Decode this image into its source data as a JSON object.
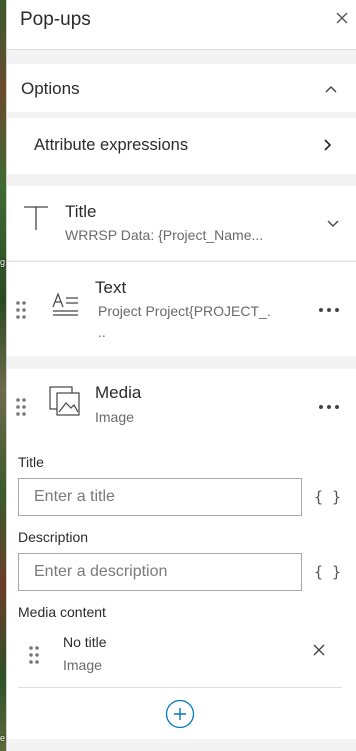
{
  "map": {
    "edge_label_1": "g",
    "edge_label_2": "e"
  },
  "header": {
    "title": "Pop-ups"
  },
  "options": {
    "label": "Options",
    "attribute_expressions": "Attribute expressions"
  },
  "title_element": {
    "label": "Title",
    "value": "WRRSP Data: {Project_Name..."
  },
  "text_element": {
    "label": "Text",
    "line1": "Project Project{PROJECT_.",
    "line2": ".."
  },
  "media_element": {
    "label": "Media",
    "sub": "Image",
    "title_label": "Title",
    "title_placeholder": "Enter a title",
    "description_label": "Description",
    "description_placeholder": "Enter a description",
    "expression_glyph": "{ }",
    "media_content_label": "Media content",
    "item_title": "No title",
    "item_type": "Image"
  },
  "colors": {
    "accent": "#007ac2",
    "panel_bg": "#f3f3f3",
    "card_bg": "#ffffff"
  }
}
